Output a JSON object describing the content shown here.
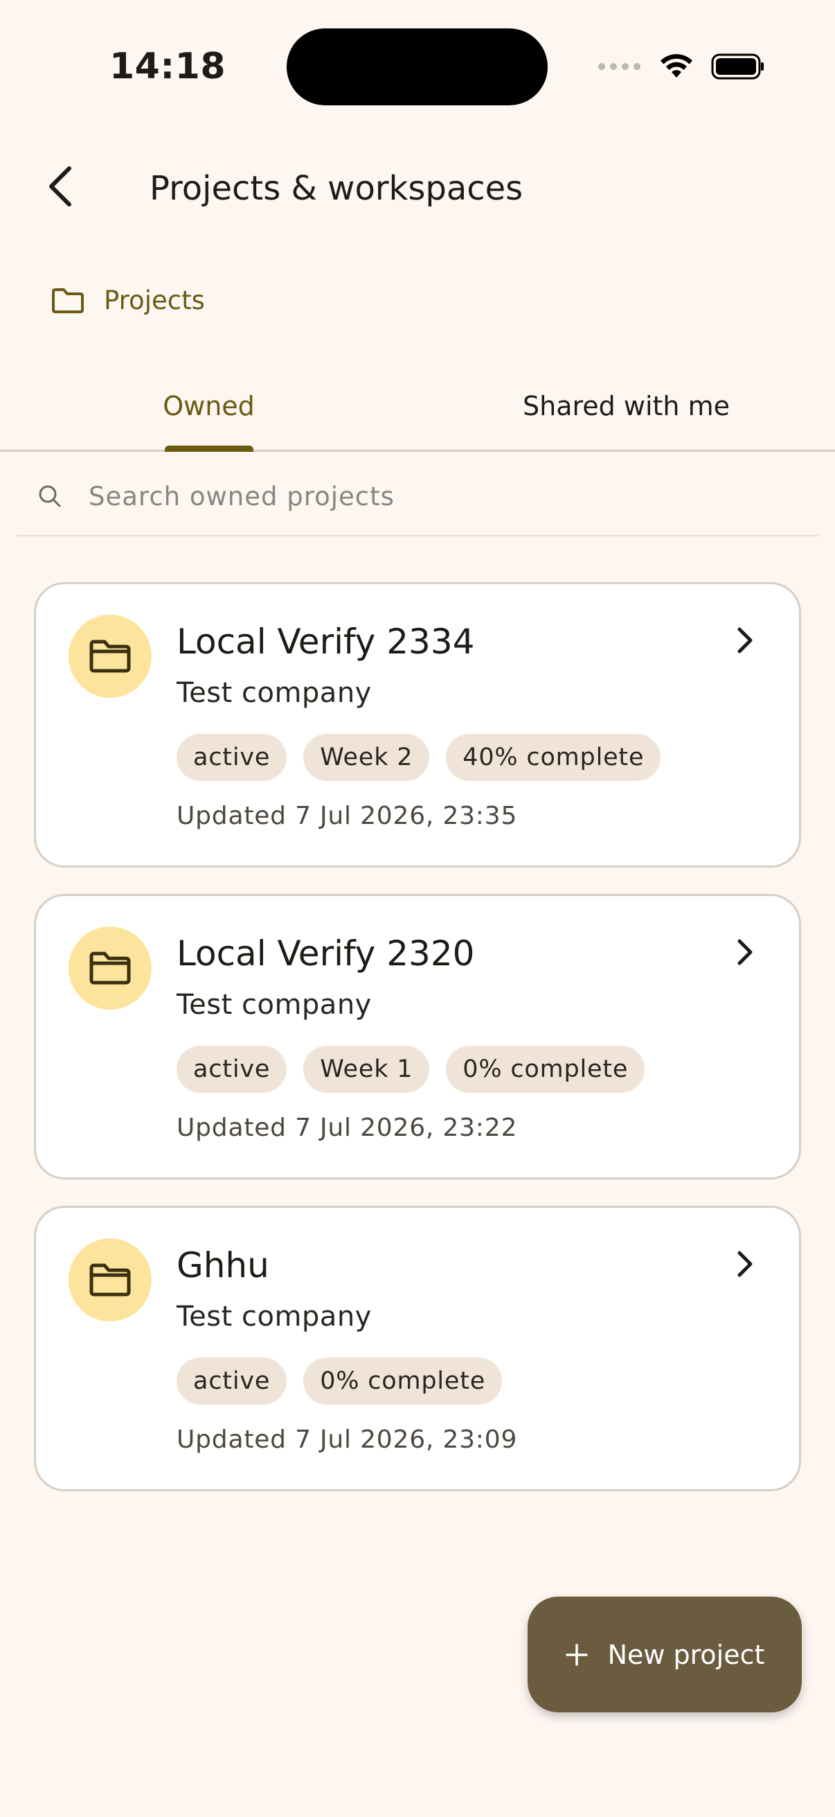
{
  "status_bar": {
    "time": "14:18"
  },
  "header": {
    "title": "Projects & workspaces"
  },
  "section": {
    "label": "Projects"
  },
  "tabs": [
    {
      "label": "Owned",
      "active": true
    },
    {
      "label": "Shared with me",
      "active": false
    }
  ],
  "search": {
    "placeholder": "Search owned projects",
    "value": ""
  },
  "projects": [
    {
      "name": "Local Verify 2334",
      "company": "Test company",
      "chips": [
        "active",
        "Week 2",
        "40% complete"
      ],
      "updated": "Updated 7 Jul 2026, 23:35"
    },
    {
      "name": "Local Verify 2320",
      "company": "Test company",
      "chips": [
        "active",
        "Week 1",
        "0% complete"
      ],
      "updated": "Updated 7 Jul 2026, 23:22"
    },
    {
      "name": "Ghhu",
      "company": "Test company",
      "chips": [
        "active",
        "0% complete"
      ],
      "updated": "Updated 7 Jul 2026, 23:09"
    }
  ],
  "fab": {
    "label": "New project"
  },
  "colors": {
    "background": "#fdf6f1",
    "accent": "#6b5a12",
    "fab": "#6b5c40",
    "avatar": "#fde49c",
    "chip": "#f0e4d8"
  }
}
